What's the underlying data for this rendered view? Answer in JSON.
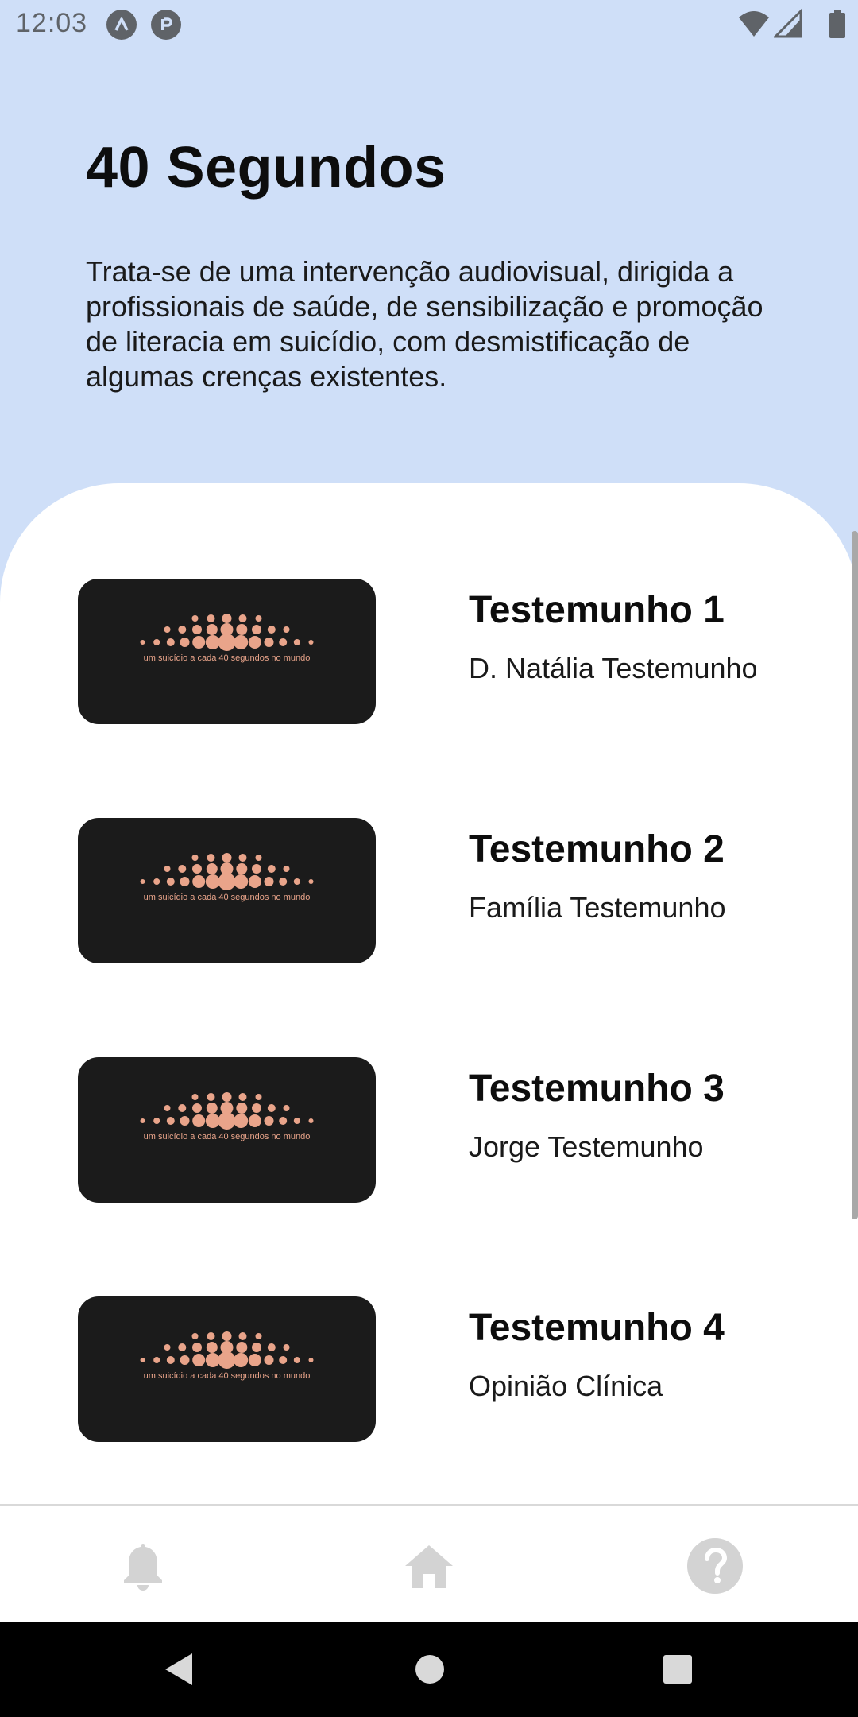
{
  "status_bar": {
    "time": "12:03",
    "left_icons": [
      "a-badge-icon",
      "r-badge-icon"
    ],
    "right_icons": [
      "wifi-icon",
      "signal-icon",
      "battery-icon"
    ]
  },
  "header": {
    "title": "40 Segundos",
    "description": "Trata-se de uma intervenção audiovisual, dirigida a profissionais de saúde, de sensibilização e promoção de literacia em suicídio, com desmistificação de algumas crenças existentes."
  },
  "thumbnail": {
    "caption": "um suicídio a cada 40 segundos no mundo",
    "accent_color": "#e9a48a"
  },
  "testimonies": [
    {
      "title": "Testemunho 1",
      "subtitle": "D. Natália Testemunho"
    },
    {
      "title": "Testemunho 2",
      "subtitle": "Família Testemunho"
    },
    {
      "title": "Testemunho 3",
      "subtitle": "Jorge Testemunho"
    },
    {
      "title": "Testemunho 4",
      "subtitle": "Opinião Clínica"
    }
  ],
  "bottom_nav": {
    "items": [
      "bell-icon",
      "home-icon",
      "help-icon"
    ]
  },
  "system_nav": {
    "items": [
      "back-icon",
      "home-circle-icon",
      "recents-icon"
    ]
  },
  "colors": {
    "header_bg": "#cfdff8",
    "sheet_bg": "#ffffff",
    "thumb_bg": "#1b1b1b",
    "nav_icon": "#d3d3d3"
  }
}
